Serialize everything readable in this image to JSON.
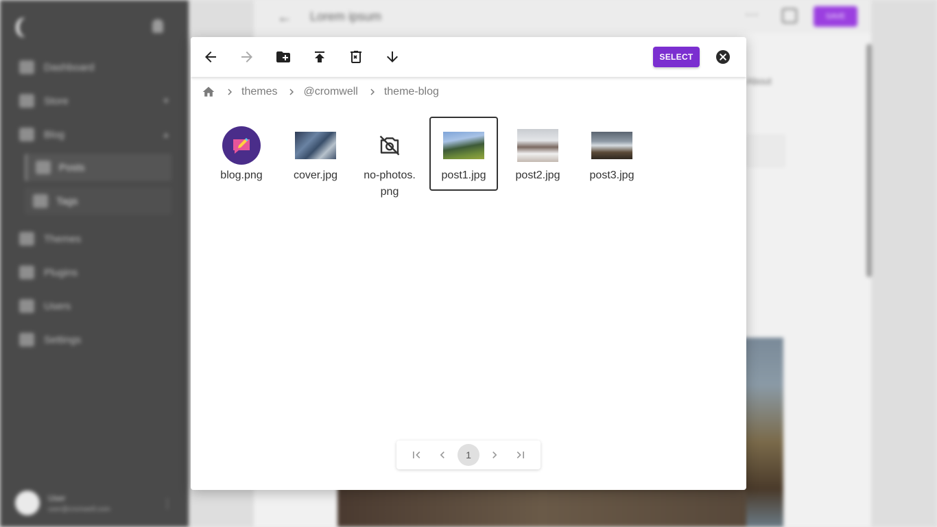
{
  "background": {
    "sidebar": {
      "items": [
        {
          "label": "Dashboard",
          "icon": "dashboard-icon"
        },
        {
          "label": "Store",
          "icon": "store-icon"
        },
        {
          "label": "Blog",
          "icon": "blog-icon"
        },
        {
          "label": "Themes",
          "icon": "themes-icon"
        },
        {
          "label": "Plugins",
          "icon": "plugins-icon"
        },
        {
          "label": "Users",
          "icon": "users-icon"
        },
        {
          "label": "Settings",
          "icon": "settings-icon"
        }
      ],
      "subitems": [
        {
          "label": "Posts"
        },
        {
          "label": "Tags"
        }
      ],
      "user": {
        "name": "User",
        "email": "user@cromwell.com"
      }
    },
    "topbar": {
      "title": "Lorem ipsum",
      "save_label": "SAVE"
    },
    "about_text": "About"
  },
  "toolbar": {
    "back_icon": "arrow-back-icon",
    "forward_icon": "arrow-forward-icon",
    "new_folder_icon": "create-folder-icon",
    "upload_icon": "upload-icon",
    "delete_icon": "delete-icon",
    "download_icon": "download-icon",
    "select_label": "SELECT",
    "close_icon": "close-circle-icon"
  },
  "breadcrumb": {
    "home_icon": "home-icon",
    "items": [
      "themes",
      "@cromwell",
      "theme-blog"
    ]
  },
  "files": [
    {
      "name": "blog.png",
      "selected": false
    },
    {
      "name": "cover.jpg",
      "selected": false
    },
    {
      "name": "no-photos.png",
      "selected": false
    },
    {
      "name": "post1.jpg",
      "selected": true
    },
    {
      "name": "post2.jpg",
      "selected": false
    },
    {
      "name": "post3.jpg",
      "selected": false
    }
  ],
  "pagination": {
    "current_page": "1",
    "first_icon": "first-page-icon",
    "prev_icon": "chevron-left-icon",
    "next_icon": "chevron-right-icon",
    "last_icon": "last-page-icon"
  },
  "colors": {
    "accent": "#7b2fd0",
    "sidebar_bg": "#4a4a4a",
    "selected_border": "#333333"
  }
}
